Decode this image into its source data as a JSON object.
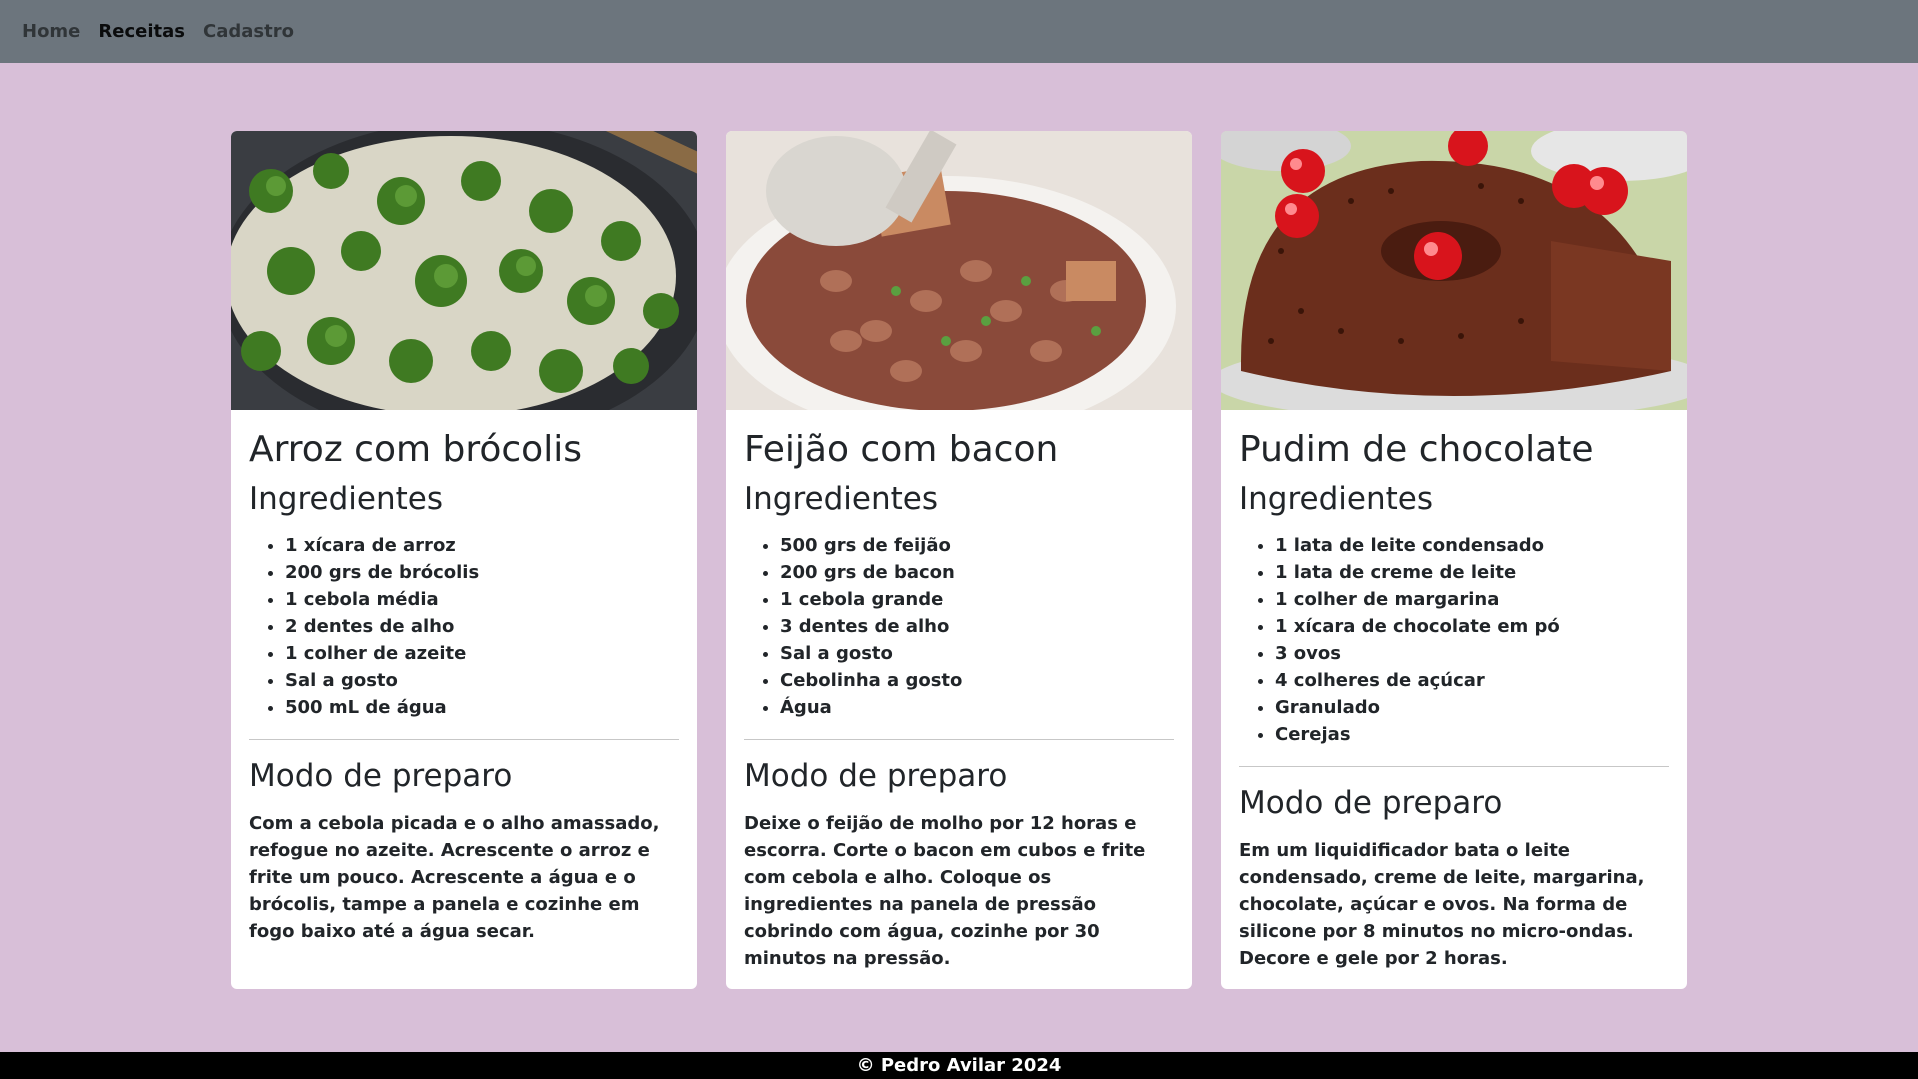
{
  "nav": {
    "items": [
      {
        "label": "Home"
      },
      {
        "label": "Receitas"
      },
      {
        "label": "Cadastro"
      }
    ]
  },
  "recipes": [
    {
      "title": "Arroz com brócolis",
      "ingredients_heading": "Ingredientes",
      "ingredients": [
        "1 xícara de arroz",
        "200 grs de brócolis",
        "1 cebola média",
        "2 dentes de alho",
        "1 colher de azeite",
        "Sal a gosto",
        "500 mL de água"
      ],
      "method_heading": "Modo de preparo",
      "method": "Com a cebola picada e o alho amassado, refogue no azeite. Acrescente o arroz e frite um pouco. Acrescente a água e o brócolis, tampe a panela e cozinhe em fogo baixo até a água secar."
    },
    {
      "title": "Feijão com bacon",
      "ingredients_heading": "Ingredientes",
      "ingredients": [
        "500 grs de feijão",
        "200 grs de bacon",
        "1 cebola grande",
        "3 dentes de alho",
        "Sal a gosto",
        "Cebolinha a gosto",
        "Água"
      ],
      "method_heading": "Modo de preparo",
      "method": "Deixe o feijão de molho por 12 horas e escorra. Corte o bacon em cubos e frite com cebola e alho. Coloque os ingredientes na panela de pressão cobrindo com água, cozinhe por 30 minutos na pressão."
    },
    {
      "title": "Pudim de chocolate",
      "ingredients_heading": "Ingredientes",
      "ingredients": [
        "1 lata de leite condensado",
        "1 lata de creme de leite",
        "1 colher de margarina",
        "1 xícara de chocolate em pó",
        "3 ovos",
        "4 colheres de açúcar",
        "Granulado",
        "Cerejas"
      ],
      "method_heading": "Modo de preparo",
      "method": "Em um liquidificador bata o leite condensado, creme de leite, margarina, chocolate, açúcar e ovos. Na forma de silicone por 8 minutos no micro-ondas. Decore e gele por 2 horas."
    }
  ],
  "footer": {
    "text": "© Pedro Avilar 2024"
  },
  "colors": {
    "page_bg": "#d8bfd8",
    "navbar_bg": "#6c757d",
    "footer_bg": "#000000"
  }
}
